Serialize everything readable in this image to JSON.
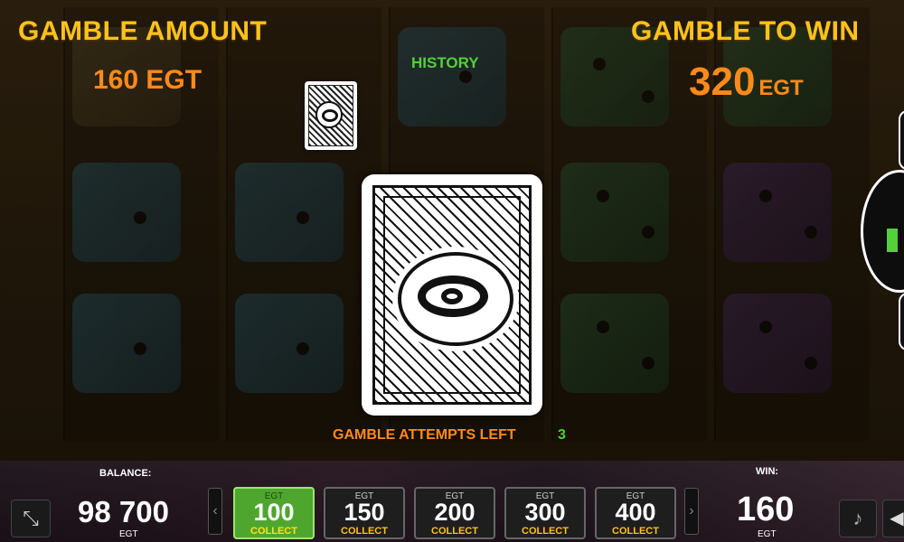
{
  "header": {
    "gamble_amount_label": "GAMBLE AMOUNT",
    "gamble_amount_value": "160",
    "gamble_amount_unit": "EGT",
    "gamble_to_win_label": "GAMBLE TO WIN",
    "gamble_to_win_value": "320",
    "gamble_to_win_unit": "EGT"
  },
  "history": {
    "label": "HISTORY"
  },
  "attempts": {
    "label": "GAMBLE ATTEMPTS LEFT",
    "value": "3"
  },
  "bottom_bar": {
    "balance_label": "BALANCE:",
    "balance_value": "98 700",
    "balance_unit": "EGT",
    "win_label": "WIN:",
    "win_value": "160",
    "win_unit": "EGT",
    "chips": [
      {
        "currency": "EGT",
        "value": "100",
        "action": "COLLECT",
        "active": true
      },
      {
        "currency": "EGT",
        "value": "150",
        "action": "COLLECT",
        "active": false
      },
      {
        "currency": "EGT",
        "value": "200",
        "action": "COLLECT",
        "active": false
      },
      {
        "currency": "EGT",
        "value": "300",
        "action": "COLLECT",
        "active": false
      },
      {
        "currency": "EGT",
        "value": "400",
        "action": "COLLECT",
        "active": false
      }
    ]
  },
  "colors": {
    "label_gold": "#ffc21a",
    "amount_orange": "#ff8a1a",
    "history_green": "#53d03a",
    "active_chip_green": "#4fa62e"
  },
  "icons": {
    "shrink": "shrink-icon",
    "music": "music-icon",
    "sound": "sound-icon",
    "card_logo": "swirl-logo-icon"
  }
}
